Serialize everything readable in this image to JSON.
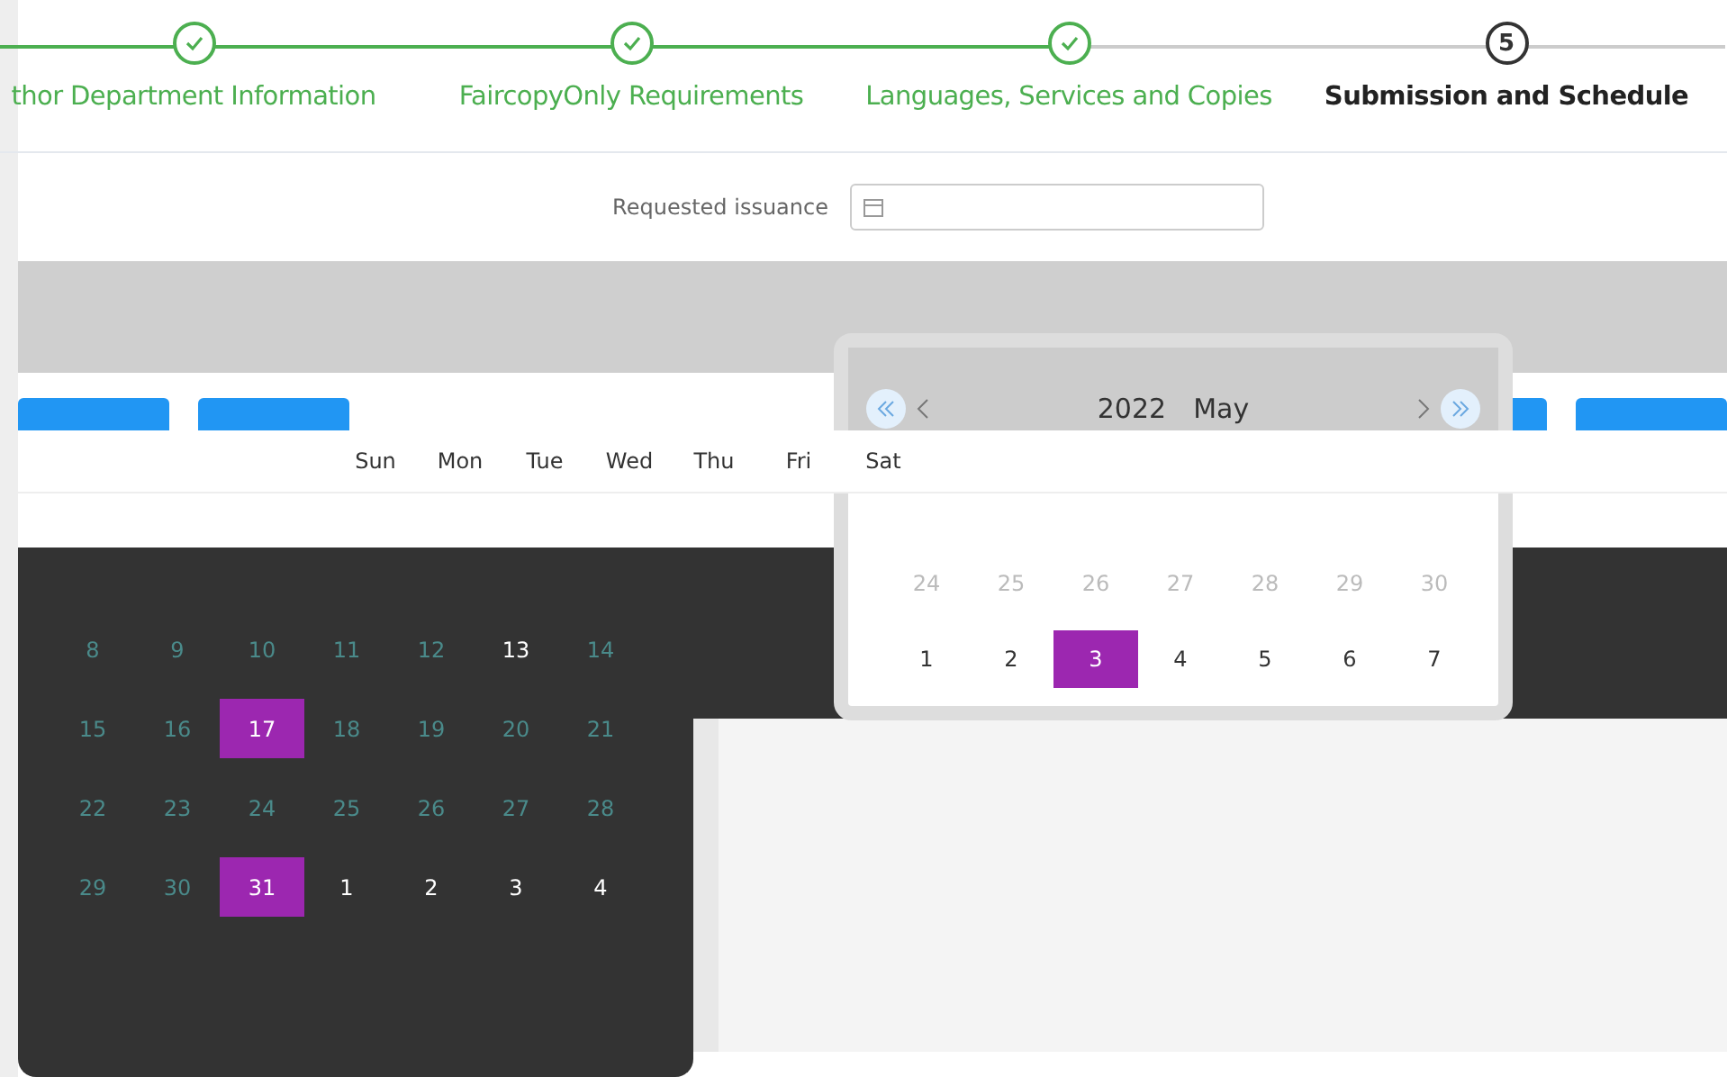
{
  "steps": [
    {
      "label": "thor Department Information",
      "done": true
    },
    {
      "label": "FaircopyOnly Requirements",
      "done": true
    },
    {
      "label": "Languages, Services and Copies",
      "done": true
    },
    {
      "label": "Submission and Schedule",
      "done": false,
      "number": "5"
    }
  ],
  "date_field": {
    "label": "Requested issuance"
  },
  "weekdays": [
    "Sun",
    "Mon",
    "Tue",
    "Wed",
    "Thu",
    "Fri",
    "Sat"
  ],
  "popup": {
    "year": "2022",
    "month": "May",
    "weeks": [
      [
        {
          "day": "24",
          "muted": true,
          "selected": false
        },
        {
          "day": "25",
          "muted": true,
          "selected": false
        },
        {
          "day": "26",
          "muted": true,
          "selected": false
        },
        {
          "day": "27",
          "muted": true,
          "selected": false
        },
        {
          "day": "28",
          "muted": true,
          "selected": false
        },
        {
          "day": "29",
          "muted": true,
          "selected": false
        },
        {
          "day": "30",
          "muted": true,
          "selected": false
        }
      ],
      [
        {
          "day": "1",
          "muted": false,
          "selected": false
        },
        {
          "day": "2",
          "muted": false,
          "selected": false
        },
        {
          "day": "3",
          "muted": false,
          "selected": true
        },
        {
          "day": "4",
          "muted": false,
          "selected": false
        },
        {
          "day": "5",
          "muted": false,
          "selected": false
        },
        {
          "day": "6",
          "muted": false,
          "selected": false
        },
        {
          "day": "7",
          "muted": false,
          "selected": false
        }
      ]
    ]
  },
  "calendar": {
    "weeks": [
      [
        {
          "day": "8",
          "muted": true,
          "selected": false
        },
        {
          "day": "9",
          "muted": true,
          "selected": false
        },
        {
          "day": "10",
          "muted": true,
          "selected": false
        },
        {
          "day": "11",
          "muted": true,
          "selected": false
        },
        {
          "day": "12",
          "muted": true,
          "selected": false
        },
        {
          "day": "13",
          "muted": false,
          "selected": false
        },
        {
          "day": "14",
          "muted": true,
          "selected": false
        }
      ],
      [
        {
          "day": "15",
          "muted": true,
          "selected": false
        },
        {
          "day": "16",
          "muted": true,
          "selected": false
        },
        {
          "day": "17",
          "muted": false,
          "selected": true
        },
        {
          "day": "18",
          "muted": true,
          "selected": false
        },
        {
          "day": "19",
          "muted": true,
          "selected": false
        },
        {
          "day": "20",
          "muted": true,
          "selected": false
        },
        {
          "day": "21",
          "muted": true,
          "selected": false
        }
      ],
      [
        {
          "day": "22",
          "muted": true,
          "selected": false
        },
        {
          "day": "23",
          "muted": true,
          "selected": false
        },
        {
          "day": "24",
          "muted": true,
          "selected": false
        },
        {
          "day": "25",
          "muted": true,
          "selected": false
        },
        {
          "day": "26",
          "muted": true,
          "selected": false
        },
        {
          "day": "27",
          "muted": true,
          "selected": false
        },
        {
          "day": "28",
          "muted": true,
          "selected": false
        }
      ],
      [
        {
          "day": "29",
          "muted": true,
          "selected": false
        },
        {
          "day": "30",
          "muted": true,
          "selected": false
        },
        {
          "day": "31",
          "muted": false,
          "selected": true
        },
        {
          "day": "1",
          "muted": false,
          "selected": false
        },
        {
          "day": "2",
          "muted": false,
          "selected": false
        },
        {
          "day": "3",
          "muted": false,
          "selected": false
        },
        {
          "day": "4",
          "muted": false,
          "selected": false
        }
      ]
    ]
  }
}
